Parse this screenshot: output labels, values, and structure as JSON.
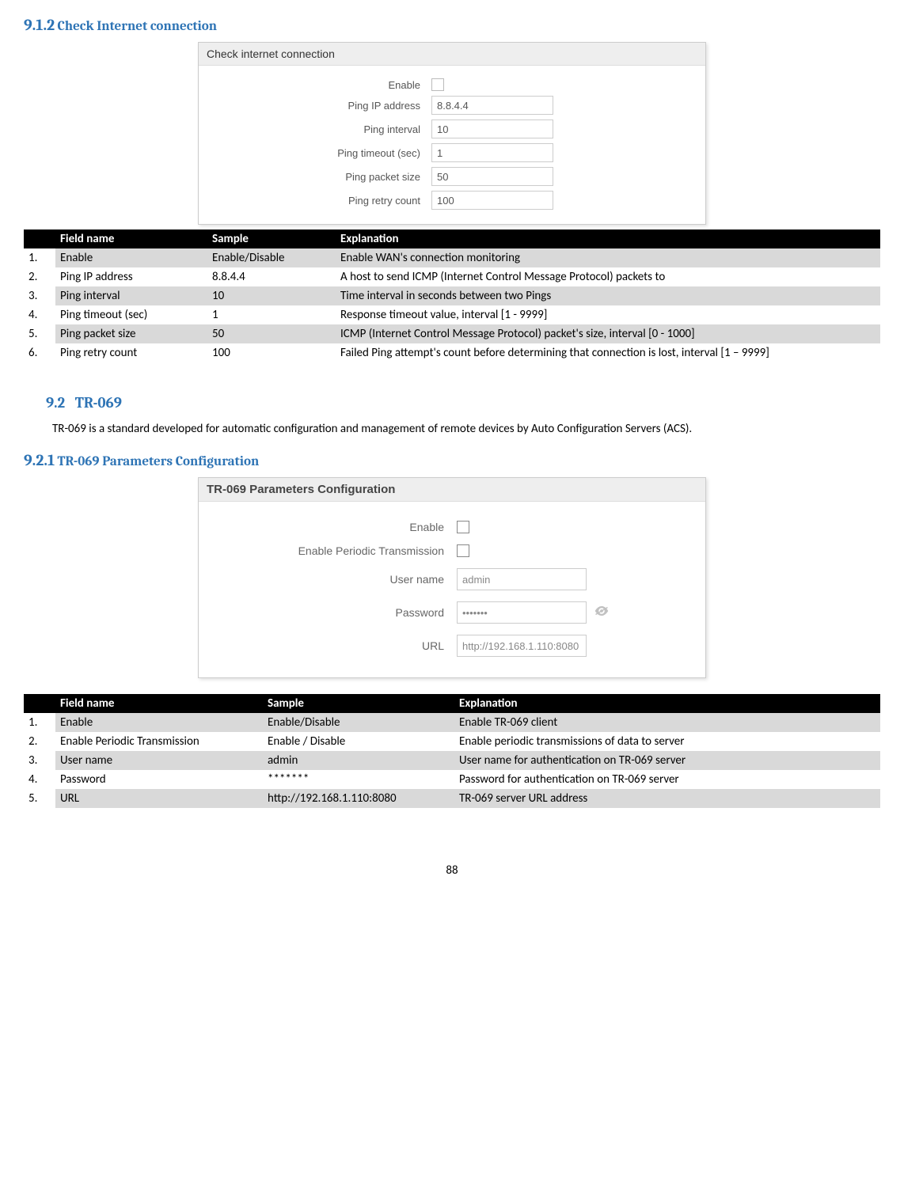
{
  "section_912": {
    "num": "9.1.2",
    "title": "Check Internet connection"
  },
  "panel1": {
    "title": "Check internet connection",
    "fields": {
      "enable": "Enable",
      "ping_ip": "Ping IP address",
      "ping_ip_val": "8.8.4.4",
      "ping_interval": "Ping interval",
      "ping_interval_val": "10",
      "ping_timeout": "Ping timeout (sec)",
      "ping_timeout_val": "1",
      "ping_packet": "Ping packet size",
      "ping_packet_val": "50",
      "ping_retry": "Ping retry count",
      "ping_retry_val": "100"
    }
  },
  "table1": {
    "headers": {
      "field": "Field name",
      "sample": "Sample",
      "expl": "Explanation"
    },
    "rows": [
      {
        "n": "1.",
        "f": "Enable",
        "s": "Enable/Disable",
        "e": "Enable WAN's connection monitoring"
      },
      {
        "n": "2.",
        "f": "Ping IP address",
        "s": "8.8.4.4",
        "e": "A host to send ICMP (Internet Control Message Protocol) packets to"
      },
      {
        "n": "3.",
        "f": "Ping interval",
        "s": "10",
        "e": "Time interval in seconds between two Pings"
      },
      {
        "n": "4.",
        "f": "Ping timeout (sec)",
        "s": "1",
        "e": "Response timeout value, interval [1 - 9999]"
      },
      {
        "n": "5.",
        "f": "Ping packet size",
        "s": "50",
        "e": "ICMP (Internet Control Message Protocol) packet's size, interval [0 - 1000]"
      },
      {
        "n": "6.",
        "f": "Ping retry count",
        "s": "100",
        "e": "Failed Ping attempt's count before determining that connection is lost, interval [1 – 9999]"
      }
    ]
  },
  "section_92": {
    "num": "9.2",
    "title": "TR-069"
  },
  "tr069_para": "TR-069 is a standard developed for automatic configuration and management of remote devices by Auto Configuration Servers (ACS).",
  "section_921": {
    "num": "9.2.1",
    "title": "TR-069 Parameters Configuration"
  },
  "panel2": {
    "title": "TR-069 Parameters Configuration",
    "fields": {
      "enable": "Enable",
      "enable_periodic": "Enable Periodic Transmission",
      "user": "User name",
      "user_val": "admin",
      "pass": "Password",
      "pass_val": "•••••••",
      "url": "URL",
      "url_val": "http://192.168.1.110:8080"
    }
  },
  "table2": {
    "headers": {
      "field": "Field name",
      "sample": "Sample",
      "expl": "Explanation"
    },
    "rows": [
      {
        "n": "1.",
        "f": "Enable",
        "s": "Enable/Disable",
        "e": "Enable TR-069 client"
      },
      {
        "n": "2.",
        "f": "Enable Periodic Transmission",
        "s": "Enable / Disable",
        "e": "Enable periodic transmissions of data to server"
      },
      {
        "n": "3.",
        "f": "User name",
        "s": "admin",
        "e": "User name for authentication on TR-069 server"
      },
      {
        "n": "4.",
        "f": "Password",
        "s": "*******",
        "e": "Password for authentication on TR-069 server"
      },
      {
        "n": "5.",
        "f": "URL",
        "s": "http://192.168.1.110:8080",
        "e": "TR-069 server URL address"
      }
    ]
  },
  "page_number": "88"
}
